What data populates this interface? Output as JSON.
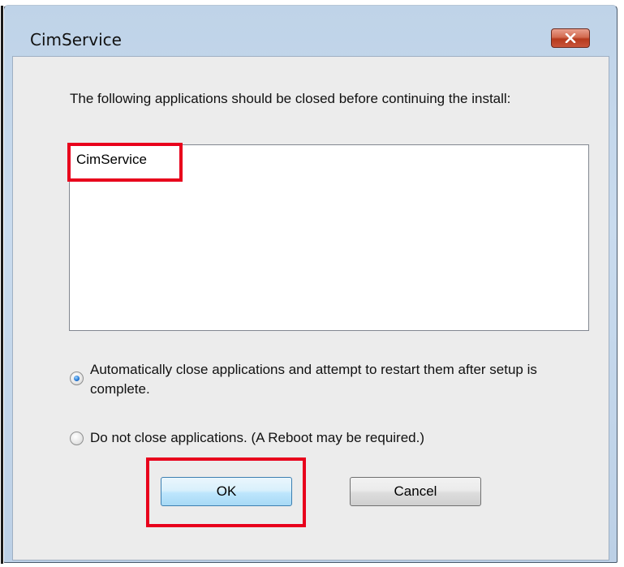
{
  "window": {
    "title": "CimService",
    "close_icon": "close-x-icon"
  },
  "message": "The following applications should be closed before continuing the install:",
  "applications": [
    "CimService"
  ],
  "options": [
    {
      "label": "Automatically close applications and attempt to restart them after setup is complete.",
      "selected": true
    },
    {
      "label": "Do not close applications. (A Reboot may be required.)",
      "selected": false
    }
  ],
  "buttons": {
    "ok_label": "OK",
    "cancel_label": "Cancel"
  },
  "colors": {
    "highlight": "#e8001c",
    "ok_border": "#3c7fb1"
  }
}
